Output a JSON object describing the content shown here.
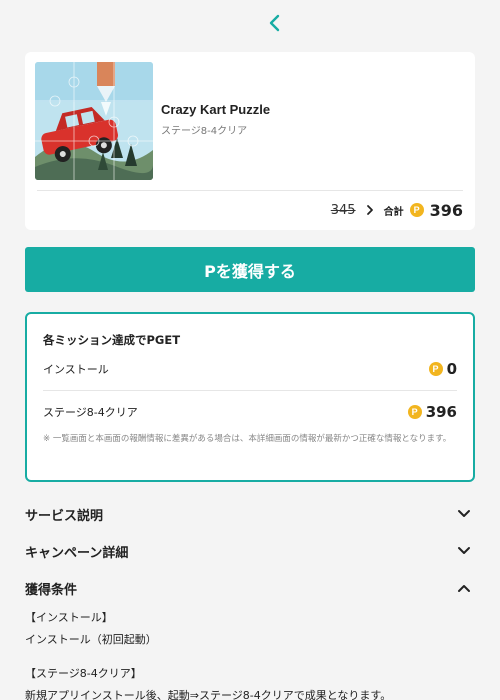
{
  "nav": {
    "back_icon": "chevron-left-icon"
  },
  "app": {
    "title": "Crazy Kart Puzzle",
    "subtitle": "ステージ8-4クリア",
    "old_points": "345",
    "total_label": "合計",
    "total_points": "396",
    "coin_symbol": "P"
  },
  "cta": {
    "label": "Pを獲得する"
  },
  "missions": {
    "heading": "各ミッション達成でPGET",
    "rows": [
      {
        "name": "インストール",
        "points": "0"
      },
      {
        "name": "ステージ8-4クリア",
        "points": "396"
      }
    ],
    "note": "※ 一覧画面と本画面の報酬情報に差異がある場合は、本詳細画面の情報が最新かつ正確な情報となります。"
  },
  "sections": [
    {
      "title": "サービス説明",
      "expanded": false
    },
    {
      "title": "キャンペーン詳細",
      "expanded": false
    },
    {
      "title": "獲得条件",
      "expanded": true
    }
  ],
  "conditions": {
    "line1": "【インストール】",
    "line2": "インストール（初回起動）",
    "line3": "【ステージ8-4クリア】",
    "line4": "新規アプリインストール後、起動⇒ステージ8-4クリアで成果となります。"
  },
  "colors": {
    "accent": "#17aca3",
    "coin": "#f2b51f",
    "background": "#f4f4f4"
  }
}
